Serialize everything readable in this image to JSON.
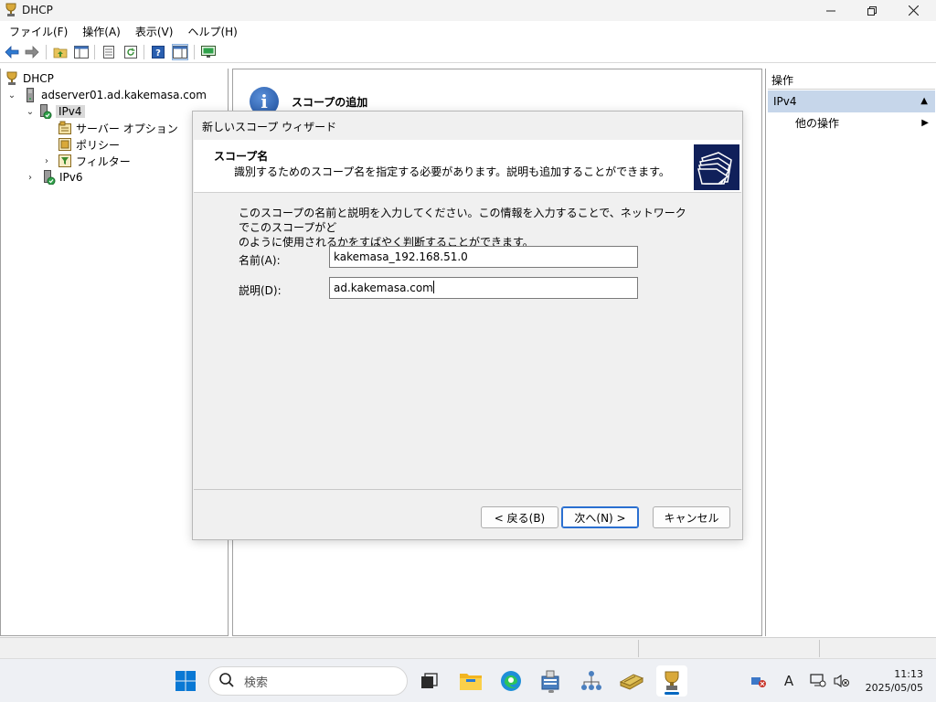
{
  "window": {
    "title": "DHCP"
  },
  "menu": [
    "ファイル(F)",
    "操作(A)",
    "表示(V)",
    "ヘルプ(H)"
  ],
  "tree": {
    "root": "DHCP",
    "server": "adserver01.ad.kakemasa.com",
    "ipv4": "IPv4",
    "server_options": "サーバー オプション",
    "policy": "ポリシー",
    "filter": "フィルター",
    "ipv6": "IPv6"
  },
  "middle": {
    "heading": "スコープの追加"
  },
  "actions": {
    "header": "操作",
    "section": "IPv4",
    "item": "他の操作"
  },
  "wizard": {
    "title": "新しいスコープ ウィザード",
    "header_title": "スコープ名",
    "header_desc": "識別するためのスコープ名を指定する必要があります。説明も追加することができます。",
    "intro_line1": "このスコープの名前と説明を入力してください。この情報を入力することで、ネットワークでこのスコープがど",
    "intro_line2": "のように使用されるかをすばやく判断することができます。",
    "name_label": "名前(A):",
    "name_value": "kakemasa_192.168.51.0",
    "desc_label": "説明(D):",
    "desc_value": "ad.kakemasa.com",
    "back_button": "< 戻る(B)",
    "next_button": "次へ(N) >",
    "cancel_button": "キャンセル"
  },
  "taskbar": {
    "search_placeholder": "検索",
    "time": "11:13",
    "date": "2025/05/05",
    "ime": "A"
  },
  "colors": {
    "accent": "#0067c0",
    "selection": "#c6d6ea",
    "wizard_bg": "#f0f0f0"
  }
}
